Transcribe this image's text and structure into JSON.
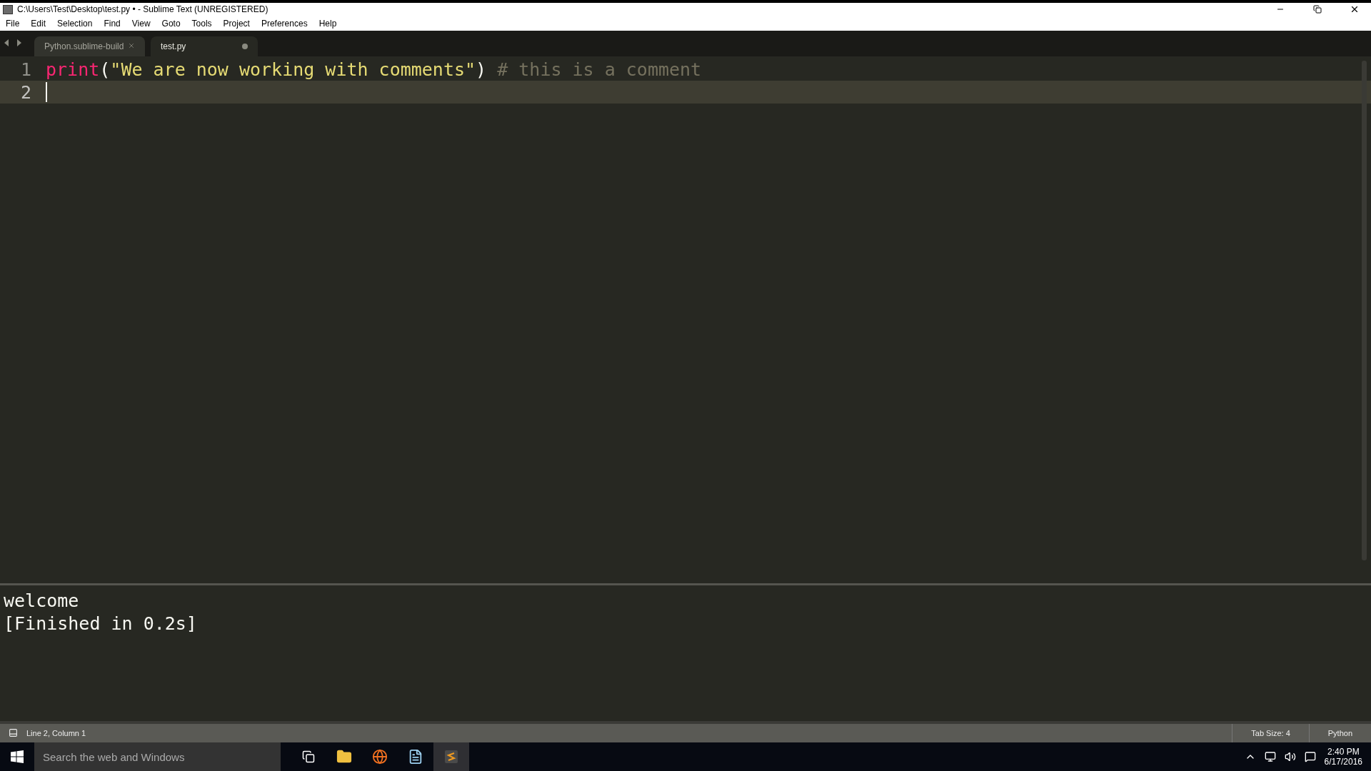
{
  "window": {
    "title": "C:\\Users\\Test\\Desktop\\test.py • - Sublime Text (UNREGISTERED)"
  },
  "menu": [
    "File",
    "Edit",
    "Selection",
    "Find",
    "View",
    "Goto",
    "Tools",
    "Project",
    "Preferences",
    "Help"
  ],
  "tabs": [
    {
      "label": "Python.sublime-build",
      "selected": false,
      "modified": false
    },
    {
      "label": "test.py",
      "selected": true,
      "modified": true
    }
  ],
  "editor": {
    "lines": [
      {
        "number": "1",
        "current": false,
        "tokens": [
          {
            "kind": "function",
            "text": "print"
          },
          {
            "kind": "plain",
            "text": "("
          },
          {
            "kind": "string",
            "text": "\"We are now working with comments\""
          },
          {
            "kind": "plain",
            "text": ")"
          },
          {
            "kind": "comment",
            "text": "# this is a comment"
          }
        ]
      },
      {
        "number": "2",
        "current": true
      }
    ]
  },
  "output": [
    "welcome",
    "[Finished in 0.2s]"
  ],
  "status_bar": {
    "position": "Line 2, Column 1",
    "tab_size": "Tab Size: 4",
    "syntax": "Python"
  },
  "taskbar": {
    "search": {
      "placeholder": "Search the web and Windows"
    },
    "time": "2:40 PM",
    "date": "6/17/2016"
  }
}
